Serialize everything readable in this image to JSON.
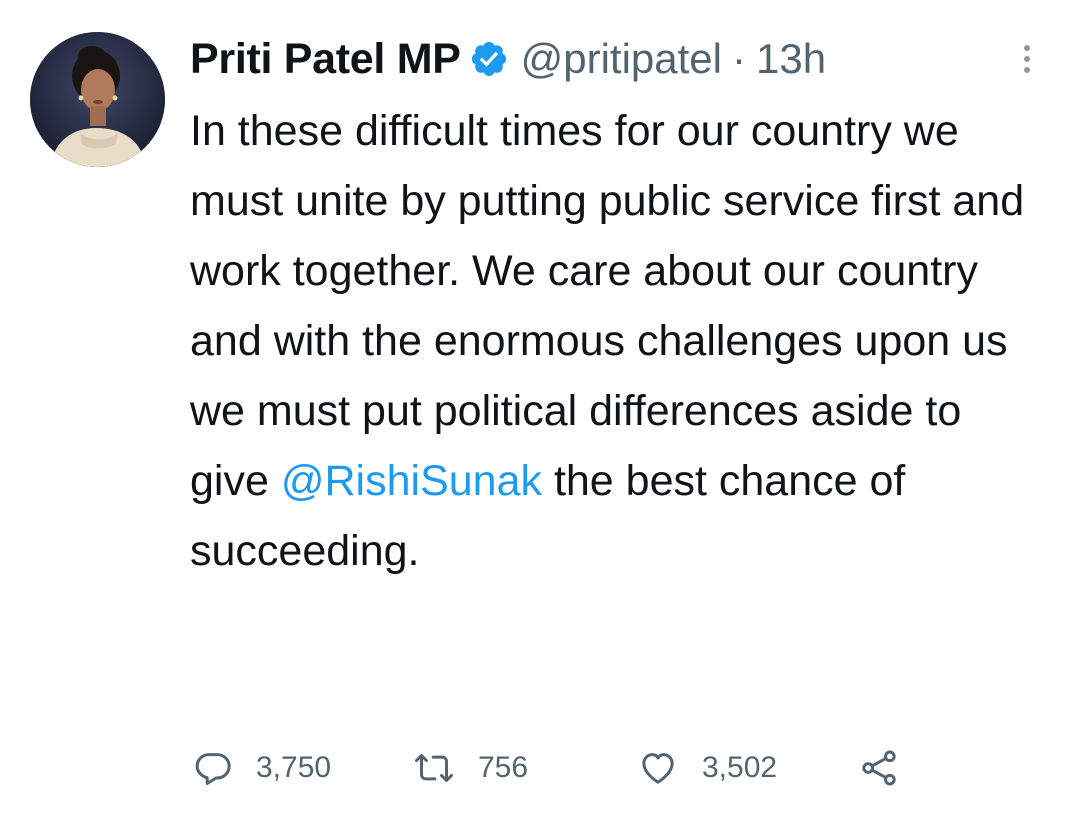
{
  "tweet": {
    "author_name": "Priti Patel MP",
    "handle": "@pritipatel",
    "separator": "·",
    "time": "13h",
    "text_before_mention": "In these difficult times for our country we must unite by putting public service first and work together. We care about our country and with the enormous challenges upon us we must put political differences aside to give ",
    "mention": "@RishiSunak",
    "text_after_mention": " the best chance of succeeding.",
    "verified_icon": "verified-badge-icon",
    "more_icon": "more-vertical-icon"
  },
  "actions": {
    "reply": {
      "icon": "reply-icon",
      "count": "3,750"
    },
    "retweet": {
      "icon": "retweet-icon",
      "count": "756"
    },
    "like": {
      "icon": "heart-icon",
      "count": "3,502"
    },
    "share": {
      "icon": "share-icon"
    }
  },
  "colors": {
    "text": "#0f1419",
    "secondary": "#536471",
    "accent": "#1d9bf0"
  }
}
